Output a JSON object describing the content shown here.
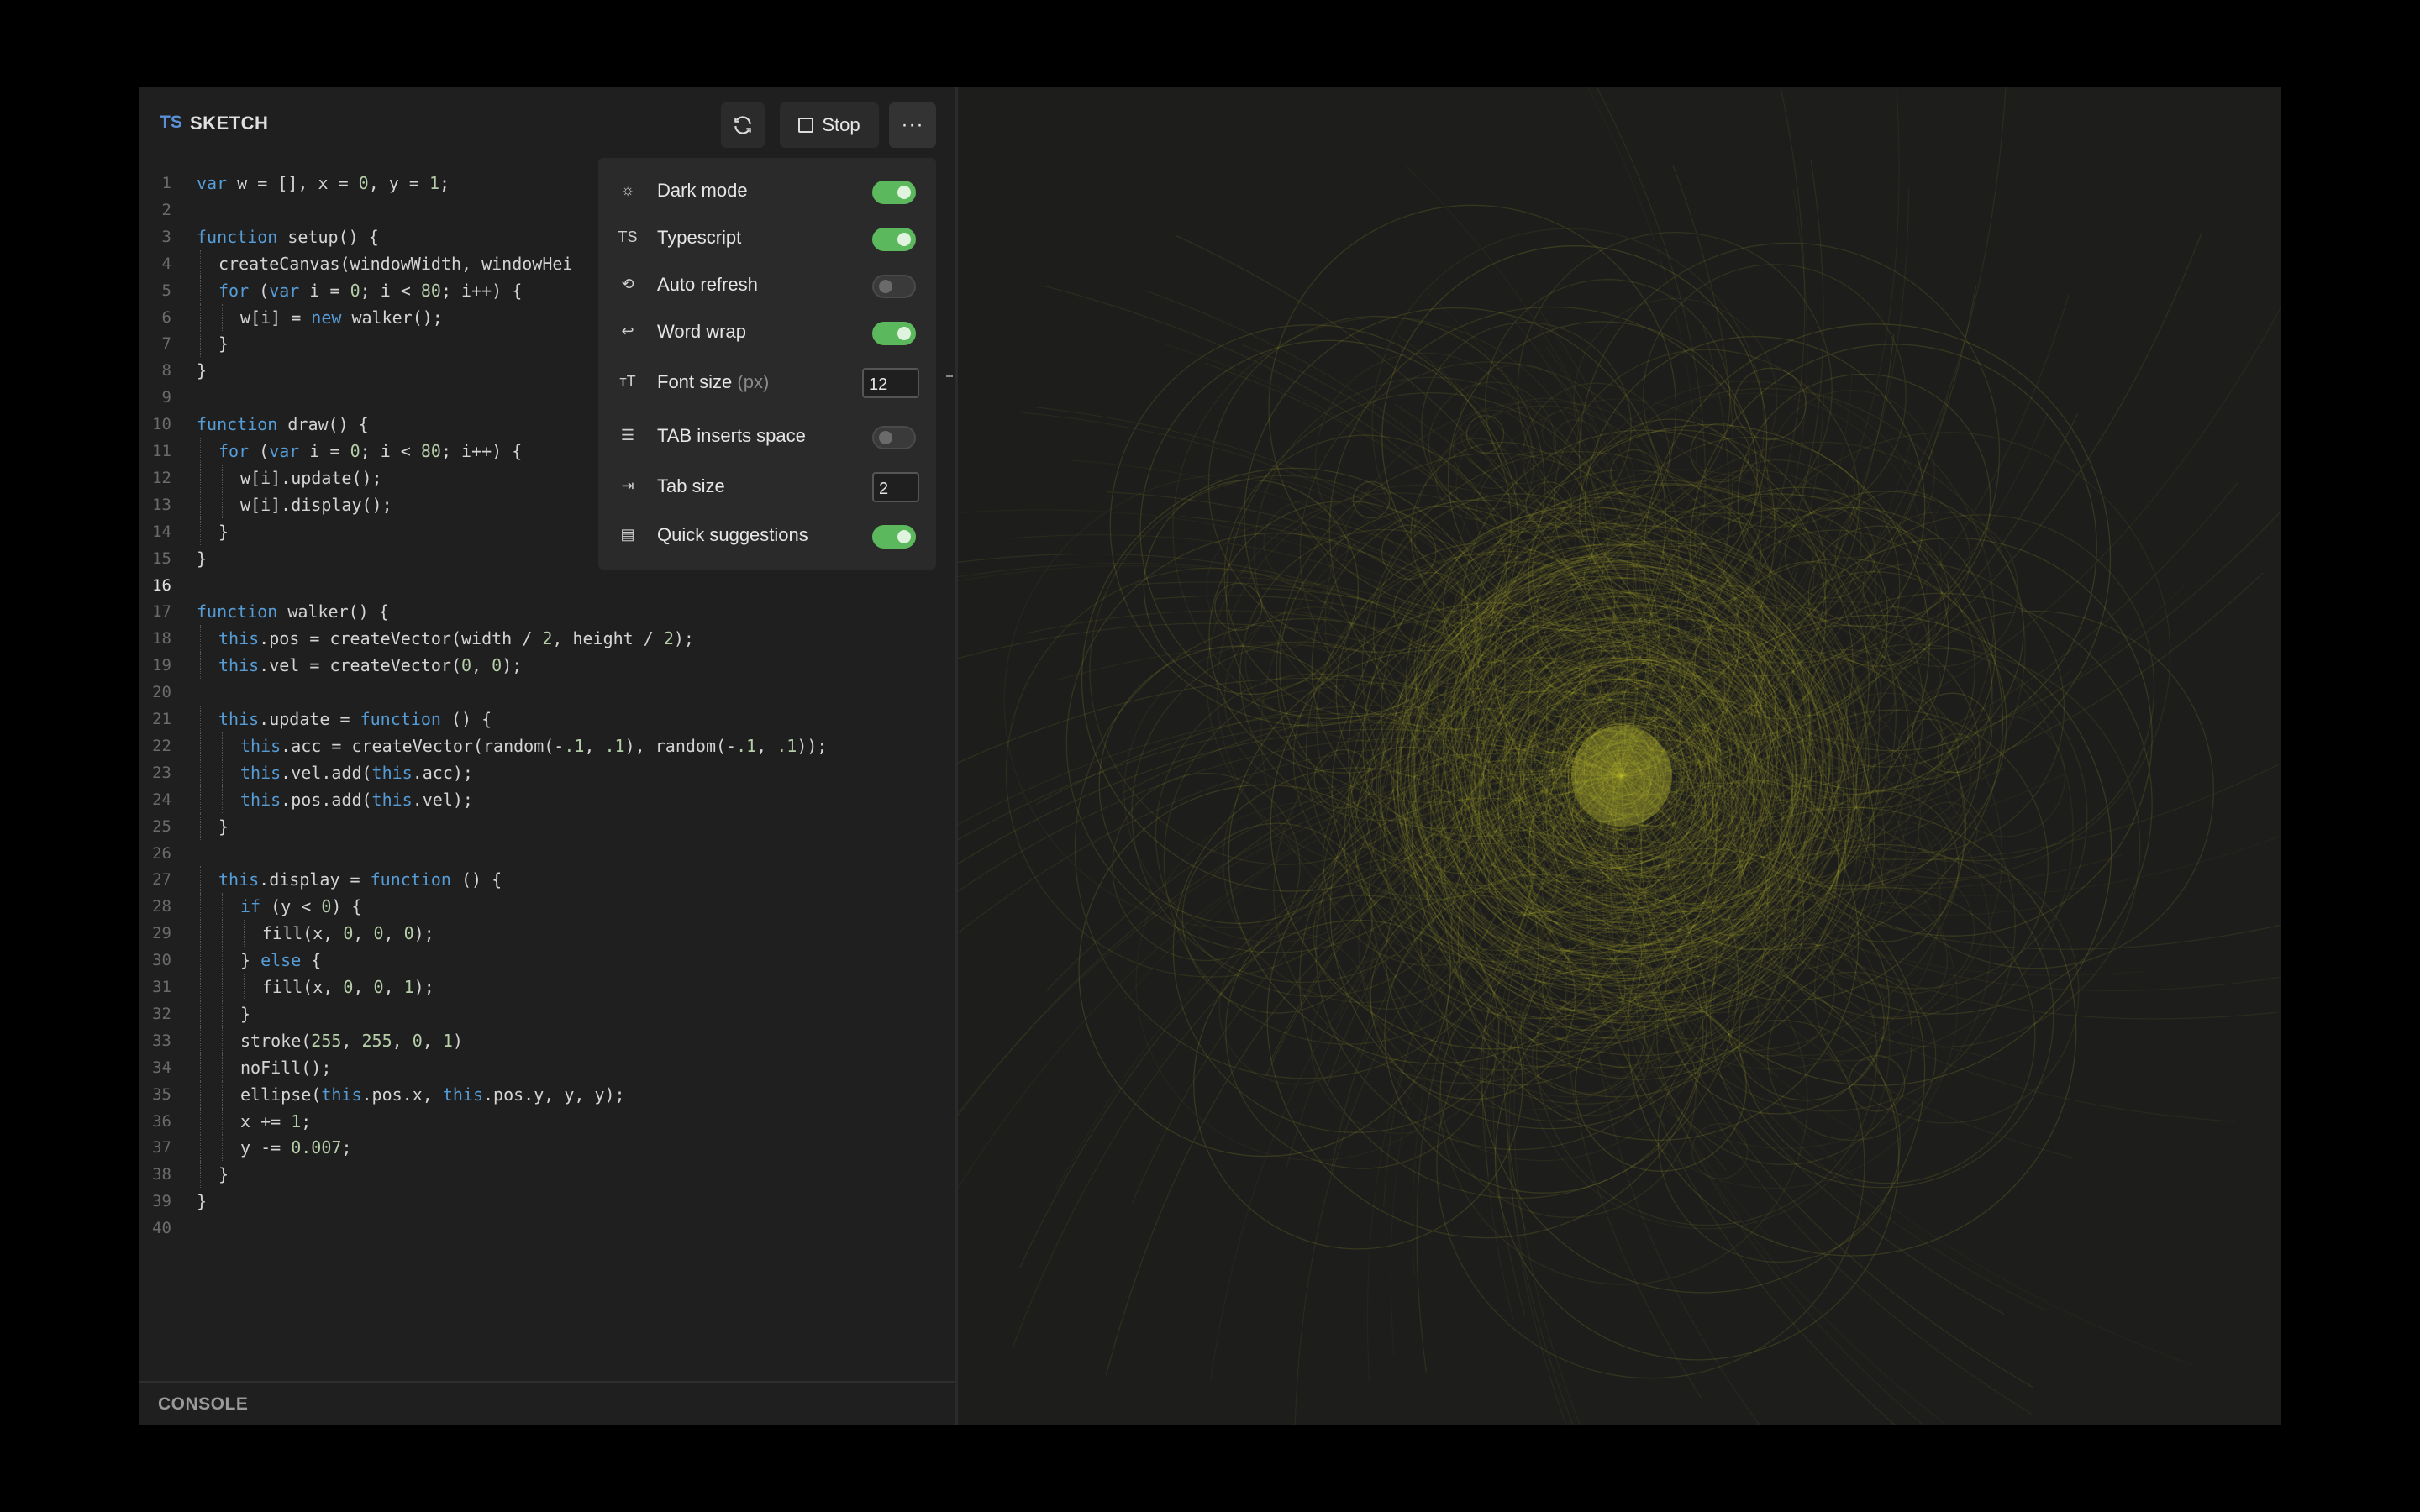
{
  "header": {
    "lang_badge": "TS",
    "title": "SKETCH",
    "stop_label": "Stop",
    "more_label": "···"
  },
  "code": {
    "lines": [
      [
        {
          "t": "var",
          "k": "kw"
        },
        {
          "t": " w = [], x = "
        },
        {
          "t": "0",
          "k": "num"
        },
        {
          "t": ", y = "
        },
        {
          "t": "1",
          "k": "num"
        },
        {
          "t": ";"
        }
      ],
      [],
      [
        {
          "t": "function",
          "k": "kw"
        },
        {
          "t": " setup() {"
        }
      ],
      [
        {
          "t": "createCanvas(windowWidth, windowHei"
        }
      ],
      [
        {
          "t": "for",
          "k": "kw"
        },
        {
          "t": " ("
        },
        {
          "t": "var",
          "k": "kw"
        },
        {
          "t": " i = "
        },
        {
          "t": "0",
          "k": "num"
        },
        {
          "t": "; i < "
        },
        {
          "t": "80",
          "k": "num"
        },
        {
          "t": "; i++) {"
        }
      ],
      [
        {
          "t": "w[i] = "
        },
        {
          "t": "new",
          "k": "kw"
        },
        {
          "t": " walker();"
        }
      ],
      [
        {
          "t": "}"
        }
      ],
      [
        {
          "t": "}"
        }
      ],
      [],
      [
        {
          "t": "function",
          "k": "kw"
        },
        {
          "t": " draw() {"
        }
      ],
      [
        {
          "t": "for",
          "k": "kw"
        },
        {
          "t": " ("
        },
        {
          "t": "var",
          "k": "kw"
        },
        {
          "t": " i = "
        },
        {
          "t": "0",
          "k": "num"
        },
        {
          "t": "; i < "
        },
        {
          "t": "80",
          "k": "num"
        },
        {
          "t": "; i++) {"
        }
      ],
      [
        {
          "t": "w[i].update();"
        }
      ],
      [
        {
          "t": "w[i].display();"
        }
      ],
      [
        {
          "t": "}"
        }
      ],
      [
        {
          "t": "}"
        }
      ],
      [],
      [
        {
          "t": "function",
          "k": "kw"
        },
        {
          "t": " walker() {"
        }
      ],
      [
        {
          "t": "this",
          "k": "kw"
        },
        {
          "t": ".pos = createVector(width / "
        },
        {
          "t": "2",
          "k": "num"
        },
        {
          "t": ", height / "
        },
        {
          "t": "2",
          "k": "num"
        },
        {
          "t": ");"
        }
      ],
      [
        {
          "t": "this",
          "k": "kw"
        },
        {
          "t": ".vel = createVector("
        },
        {
          "t": "0",
          "k": "num"
        },
        {
          "t": ", "
        },
        {
          "t": "0",
          "k": "num"
        },
        {
          "t": ");"
        }
      ],
      [],
      [
        {
          "t": "this",
          "k": "kw"
        },
        {
          "t": ".update = "
        },
        {
          "t": "function",
          "k": "kw"
        },
        {
          "t": " () {"
        }
      ],
      [
        {
          "t": "this",
          "k": "kw"
        },
        {
          "t": ".acc = createVector(random(-"
        },
        {
          "t": ".1",
          "k": "num"
        },
        {
          "t": ", "
        },
        {
          "t": ".1",
          "k": "num"
        },
        {
          "t": "), random(-"
        },
        {
          "t": ".1",
          "k": "num"
        },
        {
          "t": ", "
        },
        {
          "t": ".1",
          "k": "num"
        },
        {
          "t": "));"
        }
      ],
      [
        {
          "t": "this",
          "k": "kw"
        },
        {
          "t": ".vel.add("
        },
        {
          "t": "this",
          "k": "kw"
        },
        {
          "t": ".acc);"
        }
      ],
      [
        {
          "t": "this",
          "k": "kw"
        },
        {
          "t": ".pos.add("
        },
        {
          "t": "this",
          "k": "kw"
        },
        {
          "t": ".vel);"
        }
      ],
      [
        {
          "t": "}"
        }
      ],
      [],
      [
        {
          "t": "this",
          "k": "kw"
        },
        {
          "t": ".display = "
        },
        {
          "t": "function",
          "k": "kw"
        },
        {
          "t": " () {"
        }
      ],
      [
        {
          "t": "if",
          "k": "kw"
        },
        {
          "t": " (y < "
        },
        {
          "t": "0",
          "k": "num"
        },
        {
          "t": ") {"
        }
      ],
      [
        {
          "t": "fill(x, "
        },
        {
          "t": "0",
          "k": "num"
        },
        {
          "t": ", "
        },
        {
          "t": "0",
          "k": "num"
        },
        {
          "t": ", "
        },
        {
          "t": "0",
          "k": "num"
        },
        {
          "t": ");"
        }
      ],
      [
        {
          "t": "} "
        },
        {
          "t": "else",
          "k": "kw"
        },
        {
          "t": " {"
        }
      ],
      [
        {
          "t": "fill(x, "
        },
        {
          "t": "0",
          "k": "num"
        },
        {
          "t": ", "
        },
        {
          "t": "0",
          "k": "num"
        },
        {
          "t": ", "
        },
        {
          "t": "1",
          "k": "num"
        },
        {
          "t": ");"
        }
      ],
      [
        {
          "t": "}"
        }
      ],
      [
        {
          "t": "stroke("
        },
        {
          "t": "255",
          "k": "num"
        },
        {
          "t": ", "
        },
        {
          "t": "255",
          "k": "num"
        },
        {
          "t": ", "
        },
        {
          "t": "0",
          "k": "num"
        },
        {
          "t": ", "
        },
        {
          "t": "1",
          "k": "num"
        },
        {
          "t": ")"
        }
      ],
      [
        {
          "t": "noFill();"
        }
      ],
      [
        {
          "t": "ellipse("
        },
        {
          "t": "this",
          "k": "kw"
        },
        {
          "t": ".pos.x, "
        },
        {
          "t": "this",
          "k": "kw"
        },
        {
          "t": ".pos.y, y, y);"
        }
      ],
      [
        {
          "t": "x += "
        },
        {
          "t": "1",
          "k": "num"
        },
        {
          "t": ";"
        }
      ],
      [
        {
          "t": "y -= "
        },
        {
          "t": "0.007",
          "k": "num"
        },
        {
          "t": ";"
        }
      ],
      [
        {
          "t": "}"
        }
      ],
      [
        {
          "t": "}"
        }
      ],
      []
    ],
    "indent_levels": [
      0,
      0,
      0,
      1,
      1,
      2,
      1,
      0,
      0,
      0,
      1,
      2,
      2,
      1,
      0,
      0,
      0,
      1,
      1,
      0,
      1,
      2,
      2,
      2,
      1,
      0,
      1,
      2,
      3,
      2,
      3,
      2,
      2,
      2,
      2,
      2,
      2,
      1,
      0,
      0
    ],
    "active_line": 16
  },
  "settings": [
    {
      "icon": "sun-icon",
      "glyph": "☼",
      "label": "Dark mode",
      "type": "toggle",
      "on": true
    },
    {
      "icon": "ts-icon",
      "glyph": "TS",
      "label": "Typescript",
      "type": "toggle",
      "on": true
    },
    {
      "icon": "auto-refresh-icon",
      "glyph": "⟲",
      "label": "Auto refresh",
      "type": "toggle",
      "on": false
    },
    {
      "icon": "word-wrap-icon",
      "glyph": "↩",
      "label": "Word wrap",
      "type": "toggle",
      "on": true
    },
    {
      "icon": "font-size-icon",
      "glyph": "тT",
      "label": "Font size",
      "unit": "(px)",
      "type": "number",
      "value": "12"
    },
    {
      "icon": "tab-space-icon",
      "glyph": "☰",
      "label": "TAB inserts space",
      "type": "toggle",
      "on": false
    },
    {
      "icon": "tab-size-icon",
      "glyph": "⇥",
      "label": "Tab size",
      "type": "number",
      "value": "2"
    },
    {
      "icon": "suggestions-icon",
      "glyph": "▤",
      "label": "Quick suggestions",
      "type": "toggle",
      "on": true
    }
  ],
  "console": {
    "label": "CONSOLE"
  },
  "colors": {
    "accent_toggle": "#5cb85c",
    "keyword": "#569cd6",
    "number": "#b5cea8",
    "sketch_stroke": "#c8c832"
  }
}
